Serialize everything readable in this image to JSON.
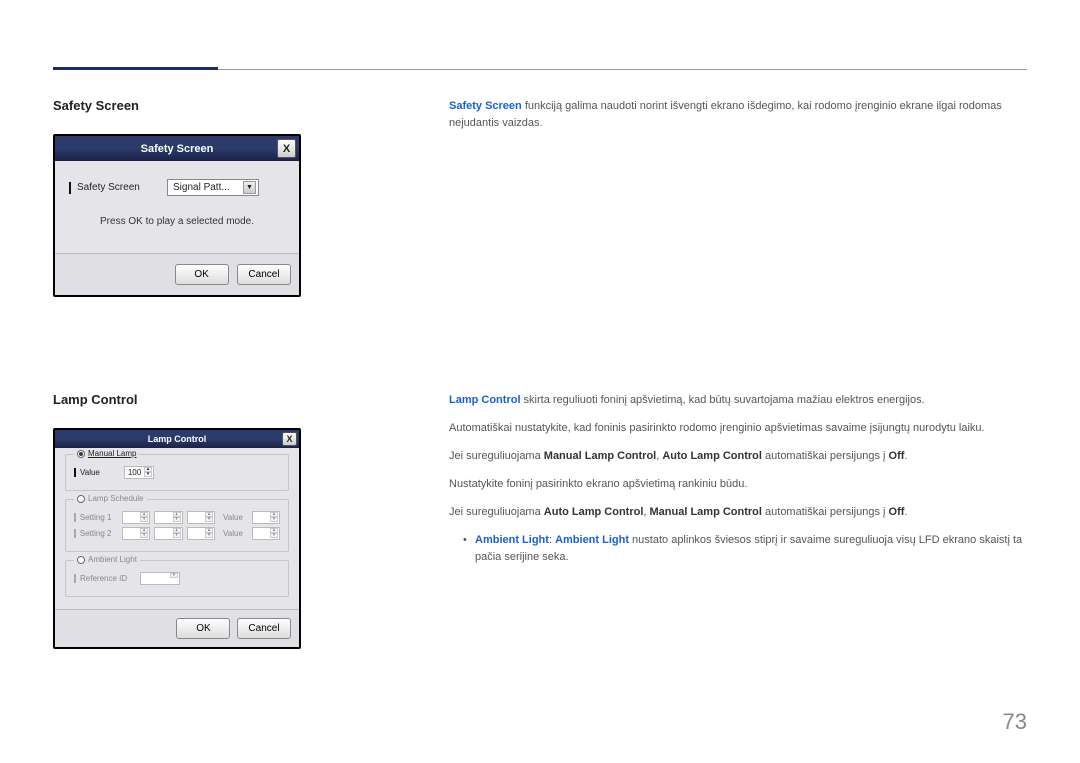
{
  "page_number": "73",
  "section1": {
    "title": "Safety Screen",
    "dialog": {
      "title": "Safety Screen",
      "close": "X",
      "row_label": "Safety Screen",
      "select_value": "Signal Patt...",
      "hint": "Press OK to play a selected mode.",
      "ok": "OK",
      "cancel": "Cancel"
    },
    "desc": {
      "hl": "Safety Screen",
      "text": " funkciją galima naudoti norint išvengti ekrano išdegimo, kai rodomo įrenginio ekrane ilgai rodomas nejudantis vaizdas."
    }
  },
  "section2": {
    "title": "Lamp Control",
    "dialog": {
      "title": "Lamp Control",
      "close": "X",
      "manual_lamp": "Manual Lamp",
      "value": "Value",
      "value_num": "100",
      "lamp_schedule": "Lamp Schedule",
      "setting1": "Setting 1",
      "setting2": "Setting 2",
      "sched_value": "Value",
      "ambient_light": "Ambient Light",
      "reference_id": "Reference ID",
      "ok": "OK",
      "cancel": "Cancel"
    },
    "desc": {
      "p1_hl": "Lamp Control",
      "p1": " skirta reguliuoti foninį apšvietimą, kad būtų suvartojama mažiau elektros energijos.",
      "p2": "Automatiškai nustatykite, kad foninis pasirinkto rodomo įrenginio apšvietimas savaime įsijungtų nurodytu laiku.",
      "p3_pre": "Jei sureguliuojama ",
      "p3_b1": "Manual Lamp Control",
      "p3_mid": ", ",
      "p3_b2": "Auto Lamp Control",
      "p3_post": " automatiškai persijungs į ",
      "p3_off": "Off",
      "p4": "Nustatykite foninį pasirinkto ekrano apšvietimą rankiniu būdu.",
      "p5_pre": "Jei sureguliuojama ",
      "p5_b1": "Auto Lamp Control",
      "p5_mid": ", ",
      "p5_b2": "Manual Lamp Control",
      "p5_post": " automatiškai persijungs į ",
      "p5_off": "Off",
      "li_hl1": "Ambient Light",
      "li_sep": ": ",
      "li_hl2": "Ambient Light",
      "li_text": " nustato aplinkos šviesos stiprį ir savaime sureguliuoja visų LFD ekrano skaistį ta pačia serijine seka."
    }
  }
}
